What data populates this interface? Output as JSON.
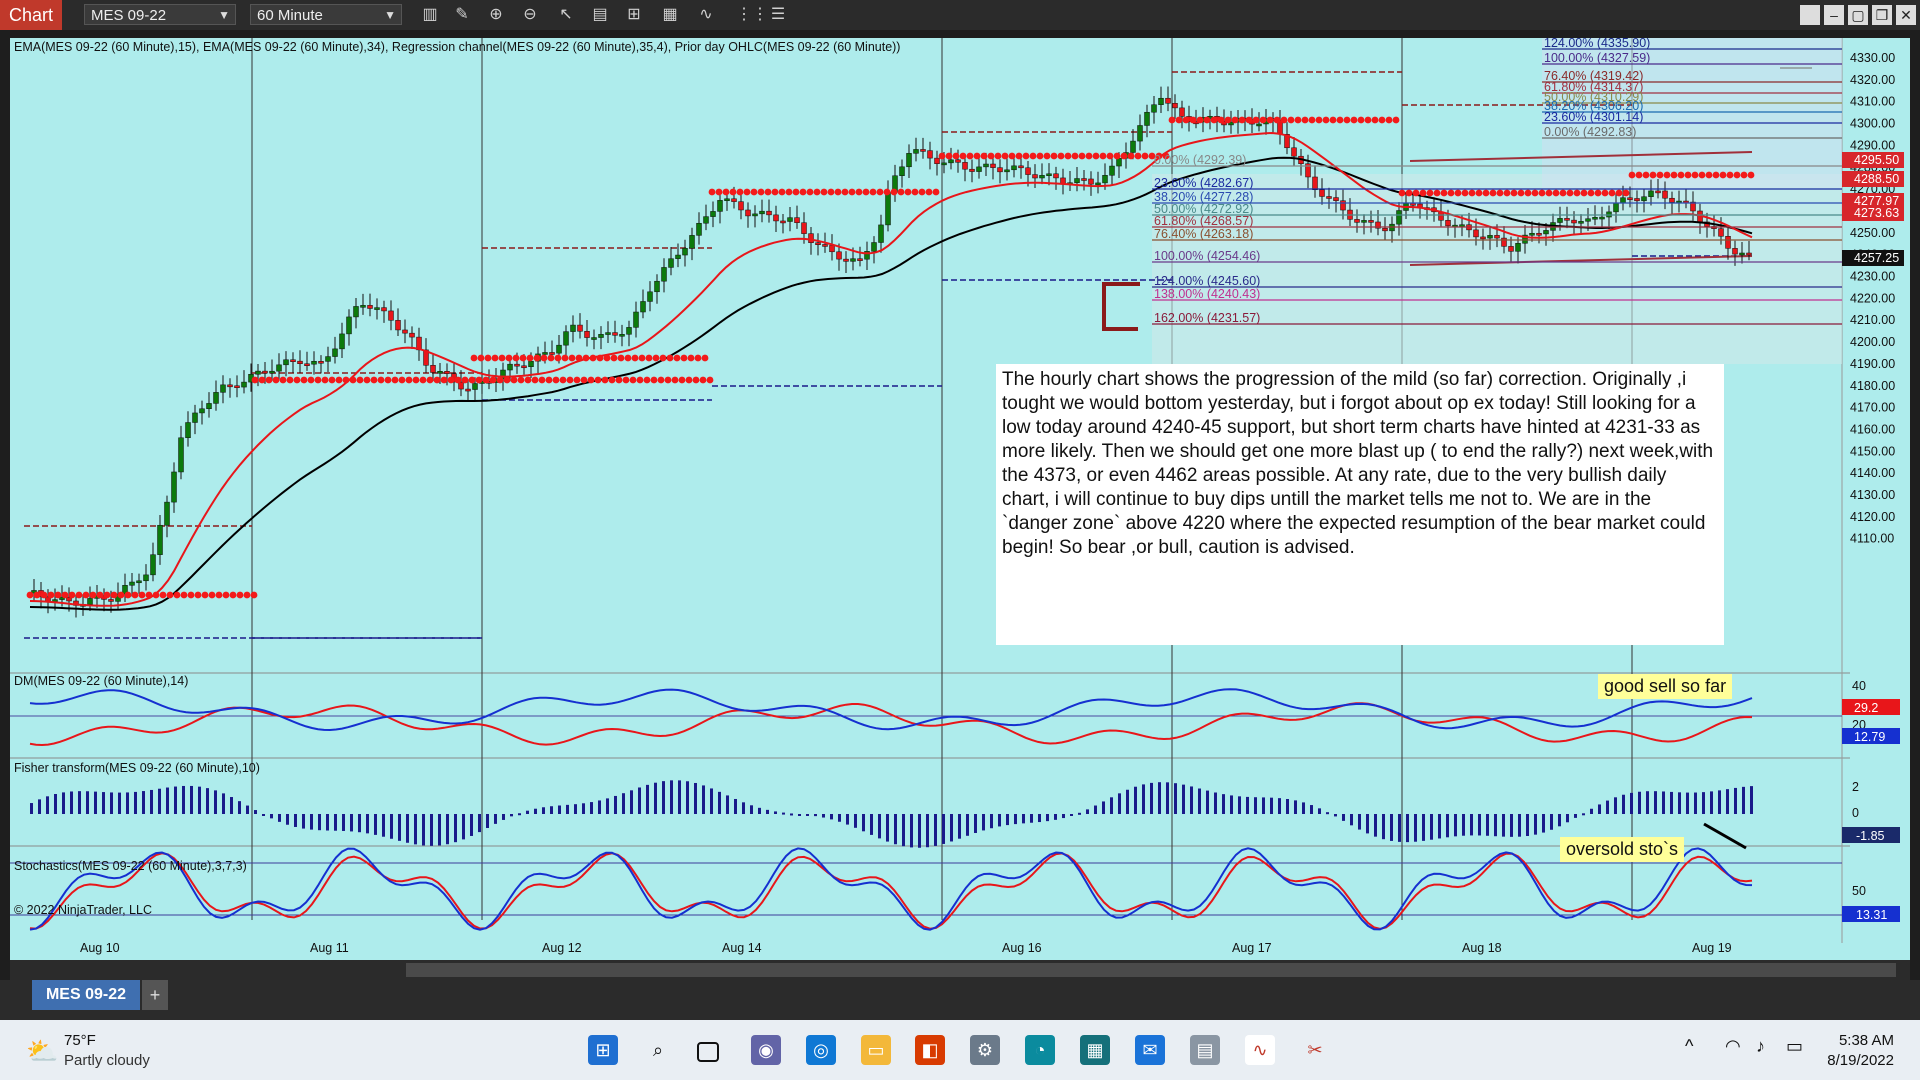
{
  "window": {
    "tab": "Chart",
    "instrument": "MES 09-22",
    "interval": "60 Minute",
    "toolbar_icons": [
      "bars-icon",
      "draw-icon",
      "zoom-in-icon",
      "zoom-out-icon",
      "pointer-icon",
      "properties-icon",
      "templates-icon",
      "data-box-icon",
      "strategy-icon",
      "grid-icon"
    ],
    "window_buttons": [
      "minimize",
      "maximize",
      "restore",
      "close"
    ]
  },
  "chart": {
    "indicators_label": "EMA(MES 09-22 (60 Minute),15), EMA(MES 09-22 (60 Minute),34), Regression channel(MES 09-22 (60 Minute),35,4), Prior day OHLC(MES 09-22 (60 Minute))",
    "copyright": "© 2022 NinjaTrader, LLC",
    "price_ticks": [
      "4330.00",
      "4320.00",
      "4310.00",
      "4300.00",
      "4290.00",
      "4280.00",
      "4270.00",
      "4260.00",
      "4250.00",
      "4240.00",
      "4230.00",
      "4220.00",
      "4210.00",
      "4200.00",
      "4190.00",
      "4180.00",
      "4170.00",
      "4160.00",
      "4150.00",
      "4140.00",
      "4130.00",
      "4120.00",
      "4110.00"
    ],
    "price_markers": [
      {
        "label": "4295.50",
        "color": "#d7262b"
      },
      {
        "label": "4288.50",
        "color": "#d7262b"
      },
      {
        "label": "4277.97",
        "color": "#d7262b"
      },
      {
        "label": "4273.63",
        "color": "#d7262b"
      },
      {
        "label": "4257.25",
        "color": "#111111"
      }
    ],
    "dates": [
      "Aug 10",
      "Aug 11",
      "Aug 12",
      "Aug 14",
      "Aug 16",
      "Aug 17",
      "Aug 18",
      "Aug 19"
    ],
    "fib_upper": [
      "124.00% (4335.90)",
      "100.00% (4327.59)",
      "76.40% (4319.42)",
      "61.80% (4314.37)",
      "50.00% (4310.29)",
      "38.20% (4306.20)",
      "23.60% (4301.14)",
      "0.00% (4292.83)"
    ],
    "fib_lower": [
      "0.00% (4292.39)",
      "23.60% (4282.67)",
      "38.20% (4277.28)",
      "50.00% (4272.92)",
      "61.80% (4268.57)",
      "76.40% (4263.18)",
      "100.00% (4254.46)",
      "124.00% (4245.60)",
      "138.00% (4240.43)",
      "162.00% (4231.57)"
    ]
  },
  "dm": {
    "label": "DM(MES 09-22 (60 Minute),14)",
    "ticks": [
      "40",
      "20"
    ],
    "markers": [
      {
        "label": "29.2",
        "color": "#e8161a"
      },
      {
        "label": "12.79",
        "color": "#1530d0"
      }
    ]
  },
  "fisher": {
    "label": "Fisher transform(MES 09-22 (60 Minute),10)",
    "ticks": [
      "2",
      "0"
    ],
    "marker": "-1.85"
  },
  "stoch": {
    "label": "Stochastics(MES 09-22 (60 Minute),3,7,3)",
    "ticks": [
      "50"
    ],
    "marker": "13.31"
  },
  "note": "The hourly chart shows the progression of the mild (so far) correction. Originally ,i tought we would bottom yesterday, but i forgot about op ex today! Still looking for a low today around 4240-45 support, but short term charts have hinted at 4231-33 as more likely. Then we should get one more blast up ( to end the rally?) next week,with the 4373, or even 4462 areas possible. At any rate, due to the very bullish daily chart, i will continue to buy dips untill the market tells me not to. We are in the `danger zone` above 4220 where the  expected resumption of the bear market could begin! So bear ,or bull, caution is advised.",
  "annotations": {
    "sell": "good sell so far",
    "oversold": "oversold sto`s"
  },
  "tabs": {
    "instrument_tab": "MES 09-22",
    "add": "+"
  },
  "taskbar": {
    "temp": "75°F",
    "weather": "Partly cloudy",
    "time": "5:38 AM",
    "date": "8/19/2022",
    "apps": [
      "windows-start-icon",
      "search-icon",
      "task-view-icon",
      "teams-icon",
      "store-icon",
      "file-explorer-icon",
      "office-icon",
      "settings-icon",
      "edge-icon",
      "calculator-grid-icon",
      "mail-icon",
      "calculator-icon",
      "ninjatrader-icon",
      "snipping-tool-icon"
    ]
  }
}
